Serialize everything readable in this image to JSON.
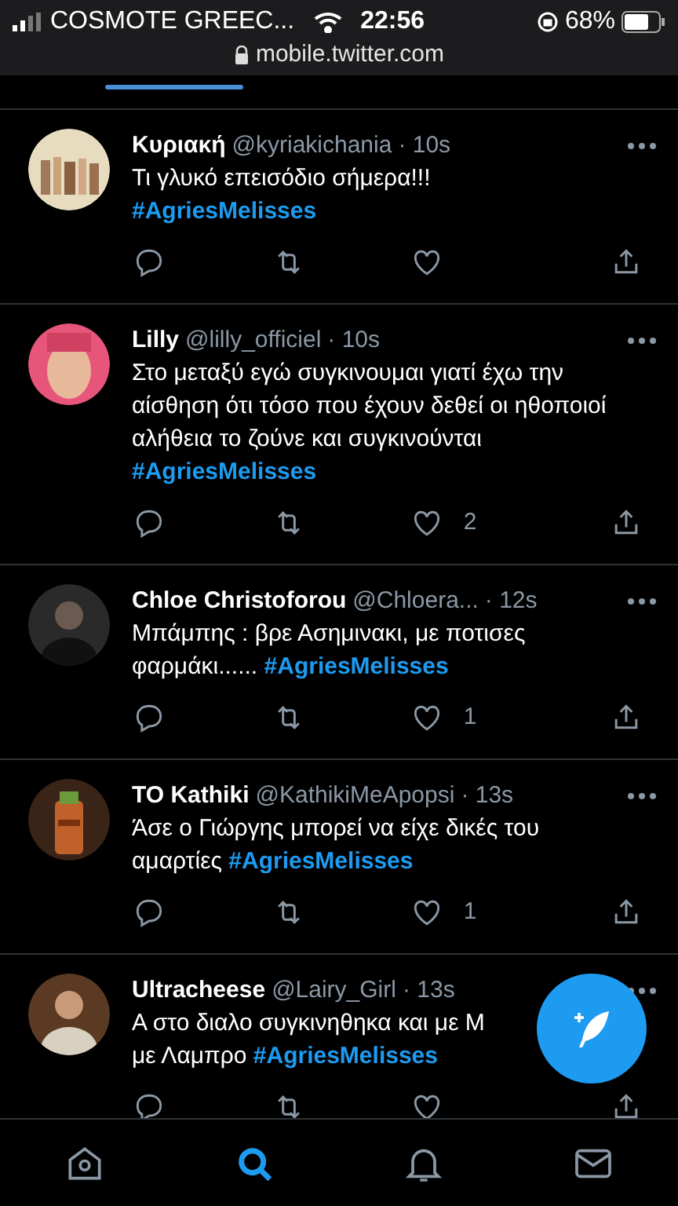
{
  "status_bar": {
    "carrier": "COSMOTE GREEC...",
    "time": "22:56",
    "battery": "68%"
  },
  "address_bar": {
    "url": "mobile.twitter.com"
  },
  "tweets": [
    {
      "name": "Κυριακή",
      "handle": "@kyriakichania",
      "time": "· 10s",
      "paragraphs": [
        [
          {
            "kind": "text",
            "text": "Τι γλυκό επεισόδιο σήμερα!!!"
          }
        ],
        [
          {
            "kind": "hashtag",
            "text": "#AgriesMelisses"
          }
        ]
      ]
    },
    {
      "name": "Lilly",
      "handle": "@lilly_officiel",
      "time": "· 10s",
      "likes": "2",
      "paragraphs": [
        [
          {
            "kind": "text",
            "text": "Στο μεταξύ εγώ συγκινουμαι γιατί έχω την αίσθηση ότι τόσο που έχουν δεθεί οι ηθοποιοί αλήθεια το ζούνε και συγκινούνται"
          }
        ],
        [
          {
            "kind": "hashtag",
            "text": "#AgriesMelisses"
          }
        ]
      ]
    },
    {
      "name": "Chloe Christoforou",
      "handle": "@Chloera...",
      "time": "· 12s",
      "likes": "1",
      "paragraphs": [
        [
          {
            "kind": "text",
            "text": "Μπάμπης : βρε Ασημινακι, με ποτισες φαρμάκι......"
          },
          {
            "kind": "hashtag",
            "text": "#AgriesMelisses"
          }
        ]
      ]
    },
    {
      "name": "TO Kathiki",
      "handle": "@KathikiMeApopsi",
      "time": "· 13s",
      "likes": "1",
      "paragraphs": [
        [
          {
            "kind": "text",
            "text": "Άσε ο Γιώργης μπορεί να είχε δικές του αμαρτίες"
          },
          {
            "kind": "hashtag",
            "text": "#AgriesMelisses"
          }
        ]
      ]
    },
    {
      "name": "Ultracheese",
      "handle": "@Lairy_Girl",
      "time": "· 13s",
      "paragraphs": [
        [
          {
            "kind": "text",
            "text": "Α στο διαλο συγκινηθηκα  και με Μ"
          }
        ],
        [
          {
            "kind": "text",
            "text": "με Λαμπρο"
          },
          {
            "kind": "hashtag",
            "text": "#AgriesMelisses"
          }
        ]
      ]
    }
  ],
  "bottom_nav": [
    {
      "kind": "home",
      "selected": false
    },
    {
      "kind": "search",
      "selected": true
    },
    {
      "kind": "bell",
      "selected": false
    },
    {
      "kind": "mail",
      "selected": false
    }
  ]
}
